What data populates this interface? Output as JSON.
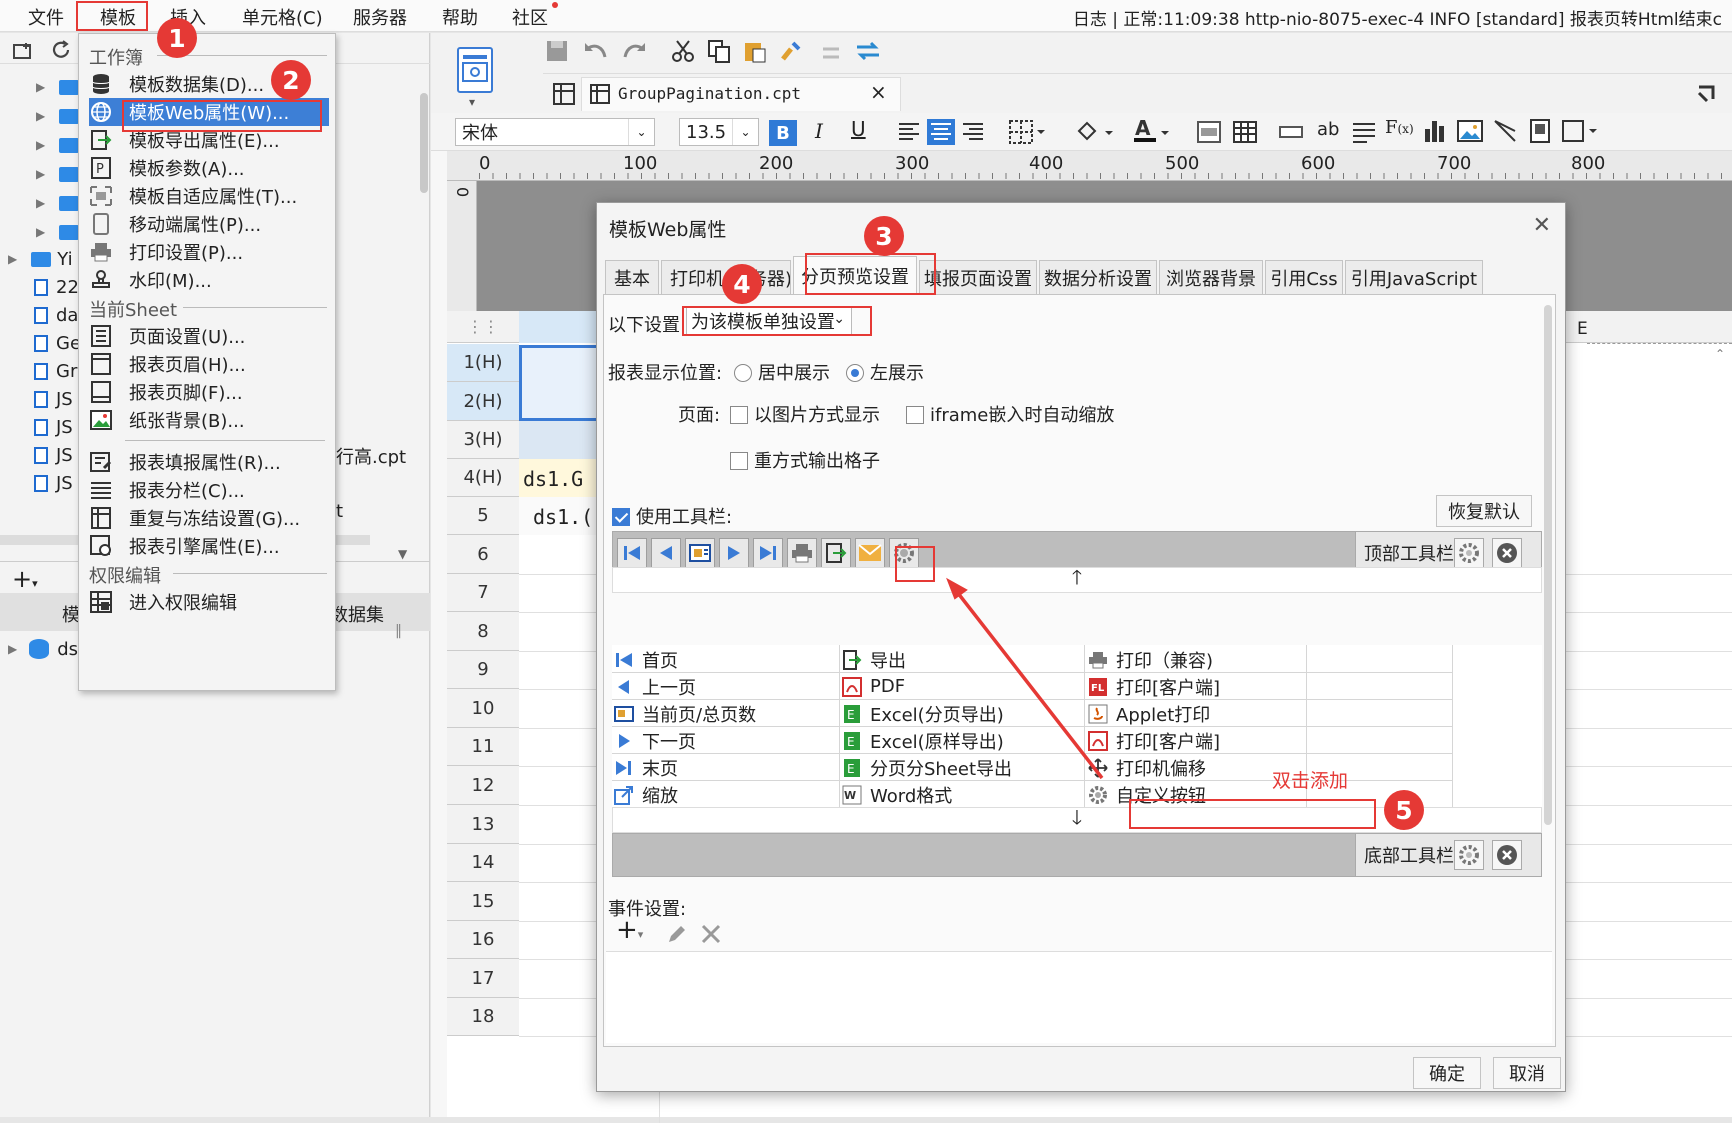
{
  "menubar": {
    "items": [
      "文件",
      "模板",
      "插入",
      "单元格(C)",
      "服务器",
      "帮助",
      "社区"
    ],
    "log": "日志 | 正常:11:09:38 http-nio-8075-exec-4 INFO [standard] 报表页转Html结束c"
  },
  "template_menu": {
    "sec_workbook": "工作簿",
    "workbook_items": [
      "模板数据集(D)...",
      "模板Web属性(W)...",
      "模板导出属性(E)...",
      "模板参数(A)...",
      "模板自适应属性(T)...",
      "移动端属性(P)...",
      "打印设置(P)...",
      "水印(M)..."
    ],
    "sec_sheet": "当前Sheet",
    "sheet_items_a": [
      "页面设置(U)...",
      "报表页眉(H)...",
      "报表页脚(F)...",
      "纸张背景(B)..."
    ],
    "sheet_items_b": [
      "报表填报属性(R)...",
      "报表分栏(C)...",
      "重复与冻结设置(G)...",
      "报表引擎属性(E)..."
    ],
    "sec_perm": "权限编辑",
    "perm_item": "进入权限编辑"
  },
  "left_panel": {
    "tree_items": [
      "Yi",
      "22",
      "da",
      "Ge",
      "Gr",
      "JS",
      "JS",
      "JS",
      "JS"
    ],
    "partial_file": "行高.cpt",
    "partial_t": "t",
    "dataset_header_left": "模",
    "dataset_header_right": "数据集",
    "dataset_item": "ds"
  },
  "editor": {
    "file_tab": "GroupPagination.cpt",
    "font_name": "宋体",
    "font_size": "13.5",
    "ruler_ticks": [
      "0",
      "100",
      "200",
      "300",
      "400",
      "500",
      "600",
      "700",
      "800"
    ],
    "rows": [
      "1(H)",
      "2(H)",
      "3(H)",
      "4(H)",
      "5",
      "6",
      "7",
      "8",
      "9",
      "10",
      "11",
      "12",
      "13",
      "14",
      "15",
      "16",
      "17",
      "18"
    ],
    "cell_ds1_a": "ds1.G",
    "cell_ds1_b": "ds1.(",
    "col_letter": "E"
  },
  "dialog": {
    "title": "模板Web属性",
    "tabs": [
      "基本",
      "打印机(服务器)",
      "分页预览设置",
      "填报页面设置",
      "数据分析设置",
      "浏览器背景",
      "引用Css",
      "引用JavaScript"
    ],
    "setting_label": "以下设置:",
    "setting_value": "为该模板单独设置",
    "position_label": "报表显示位置:",
    "position_center": "居中展示",
    "position_left": "左展示",
    "page_label": "页面:",
    "opt_image": "以图片方式显示",
    "opt_iframe": "iframe嵌入时自动缩放",
    "opt_repeat": "重方式输出格子",
    "use_toolbar": "使用工具栏:",
    "restore_default": "恢复默认",
    "top_toolbar": "顶部工具栏",
    "bottom_toolbar": "底部工具栏",
    "buttons_col1": [
      "首页",
      "上一页",
      "当前页/总页数",
      "下一页",
      "末页",
      "缩放",
      "邮件"
    ],
    "buttons_col2": [
      "导出",
      "PDF",
      "Excel(分页导出)",
      "Excel(原样导出)",
      "分页分Sheet导出",
      "Word格式",
      "打印"
    ],
    "buttons_col3": [
      "打印（兼容)",
      "打印[客户端]",
      "Applet打印",
      "打印[客户端]",
      "打印机偏移",
      "自定义按钮"
    ],
    "event_label": "事件设置:",
    "ok": "确定",
    "cancel": "取消"
  },
  "annotations": {
    "double_click_hint": "双击添加",
    "badges": [
      "1",
      "2",
      "3",
      "4",
      "5"
    ]
  },
  "colors": {
    "highlight_red": "#e53935",
    "accent_blue": "#3a7bd5"
  }
}
